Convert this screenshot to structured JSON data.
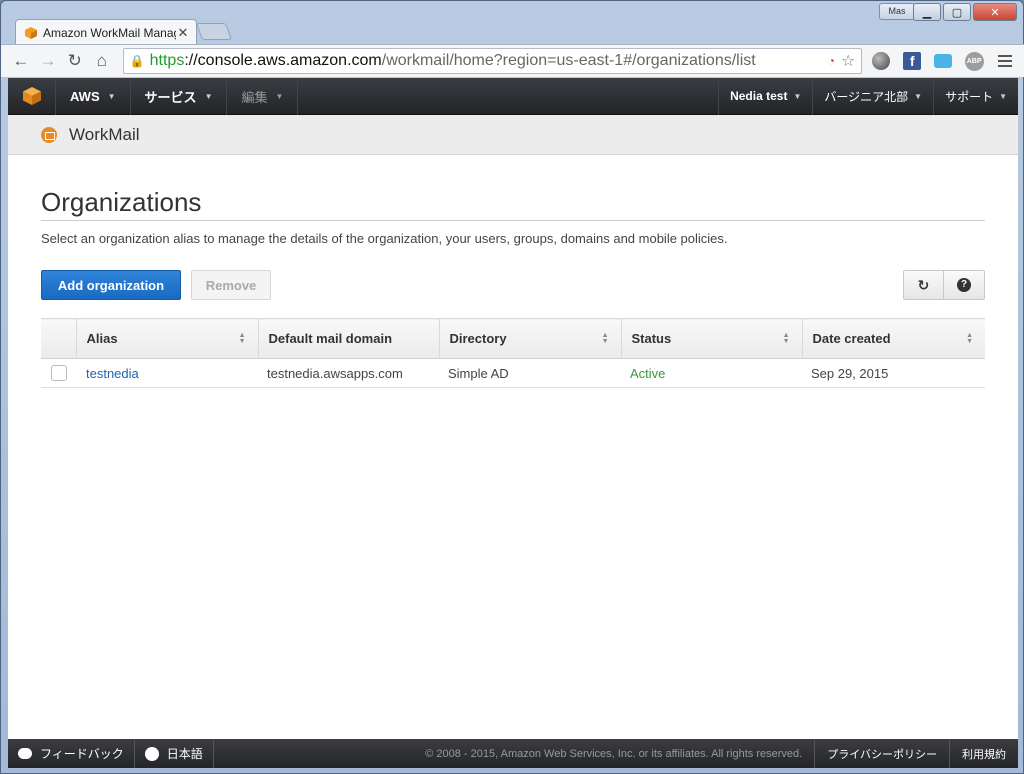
{
  "browser": {
    "tab_title": "Amazon WorkMail Manag",
    "profile": "Mas",
    "url_scheme": "https",
    "url_host": "://console.aws.amazon.com",
    "url_path": "/workmail/home?region=us-east-1#/organizations/list",
    "icons": [
      "back-icon",
      "forward-icon",
      "reload-icon",
      "home-icon",
      "lock-icon",
      "star-icon",
      "globe-icon",
      "facebook-icon",
      "chat-icon",
      "abp-icon",
      "menu-icon"
    ]
  },
  "awsnav": {
    "aws": "AWS",
    "services": "サービス",
    "edit": "編集",
    "user": "Nedia test",
    "region": "バージニア北部",
    "support": "サポート"
  },
  "service": {
    "name": "WorkMail"
  },
  "page": {
    "title": "Organizations",
    "description": "Select an organization alias to manage the details of the organization, your users, groups, domains and mobile policies.",
    "add_label": "Add organization",
    "remove_label": "Remove"
  },
  "table": {
    "columns": [
      "Alias",
      "Default mail domain",
      "Directory",
      "Status",
      "Date created"
    ],
    "rows": [
      {
        "alias": "testnedia",
        "domain": "testnedia.awsapps.com",
        "directory": "Simple AD",
        "status": "Active",
        "date": "Sep 29, 2015"
      }
    ]
  },
  "footer": {
    "feedback": "フィードバック",
    "language": "日本語",
    "copyright": "© 2008 - 2015, Amazon Web Services, Inc. or its affiliates. All rights reserved.",
    "privacy": "プライバシーポリシー",
    "terms": "利用規約"
  },
  "colors": {
    "primary": "#1a6ac2",
    "aws_orange": "#f49c1e",
    "status_active": "#3a9a3a"
  }
}
